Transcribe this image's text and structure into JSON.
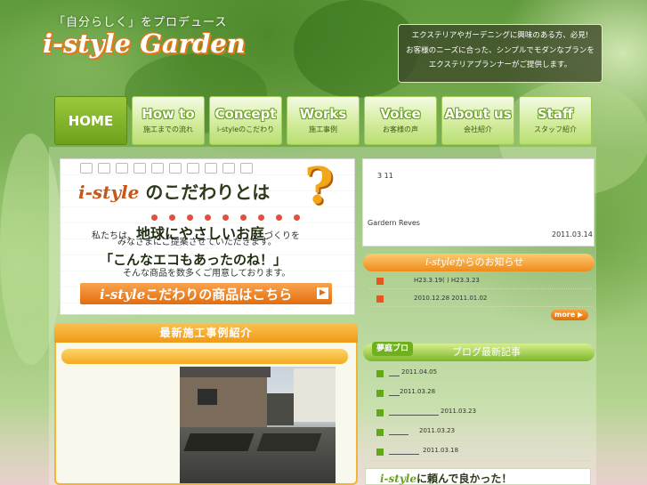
{
  "header": {
    "tagline": "「自分らしく」をプロデュース",
    "logo": "i-style Garden",
    "notice_lines": [
      "エクステリアやガーデニングに興味のある方、必見!",
      "お客様のニーズに合った、シンプルでモダンなプランを",
      "エクステリアプランナーがご提供します。"
    ]
  },
  "nav": [
    {
      "en": "HOME",
      "jp": ""
    },
    {
      "en": "How to",
      "jp": "施工までの流れ"
    },
    {
      "en": "Concept",
      "jp": "i-styleのこだわり"
    },
    {
      "en": "Works",
      "jp": "施工事例"
    },
    {
      "en": "Voice",
      "jp": "お客様の声"
    },
    {
      "en": "About us",
      "jp": "会社紹介"
    },
    {
      "en": "Staff",
      "jp": "スタッフ紹介"
    }
  ],
  "kodawari": {
    "brand": "i-style",
    "title_rest": "のこだわりとは",
    "qmark": "?",
    "line1_pre": "私たちは、",
    "line1_big": "地球にやさしいお庭",
    "line1_post": "づくりを",
    "line2": "みなさまにご提案させていただきます。",
    "line3": "「こんなエコもあったのね！」",
    "line4": "そんな商品を数多くご用意しております。",
    "cta_brand": "i-style",
    "cta_rest": "こだわりの商品はこちら",
    "cta_arrow": "▶"
  },
  "works": {
    "heading": "最新施工事例紹介"
  },
  "news": {
    "text": "3 11",
    "source": "Gardern Reves",
    "date": "2011.03.14"
  },
  "notice_bar": {
    "brand": "i-style",
    "rest": "からのお知らせ"
  },
  "notices": [
    {
      "text": "H23.3.19( ) H23.3.23"
    },
    {
      "text": "2010.12.28 2011.01.02"
    }
  ],
  "more_label": "more ▶",
  "blog": {
    "tag": "夢庭ブロ",
    "heading": "ブログ最新記事",
    "items": [
      {
        "date": "2011.04.05"
      },
      {
        "date": "2011.03.28"
      },
      {
        "date": "2011.03.23"
      },
      {
        "date": "2011.03.23"
      },
      {
        "date": "2011.03.18"
      }
    ]
  },
  "banner": {
    "brand": "i-style",
    "rest": "に頼んで良かった！"
  }
}
